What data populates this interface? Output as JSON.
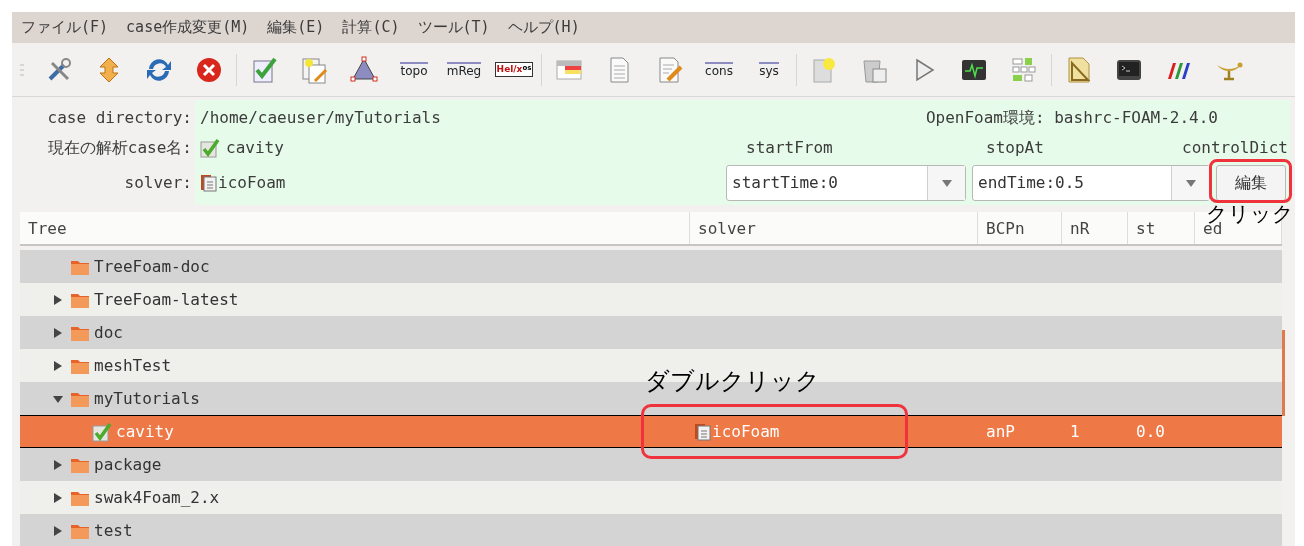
{
  "menu": [
    {
      "label": "ファイル(F)"
    },
    {
      "label": "case作成変更(M)"
    },
    {
      "label": "編集(E)"
    },
    {
      "label": "計算(C)"
    },
    {
      "label": "ツール(T)"
    },
    {
      "label": "ヘルプ(H)"
    }
  ],
  "toolbar": [
    [
      {
        "kind": "icon"
      },
      {
        "kind": "icon"
      },
      {
        "kind": "icon"
      },
      {
        "kind": "icon"
      }
    ],
    [
      {
        "kind": "icon"
      },
      {
        "kind": "icon"
      },
      {
        "kind": "icon"
      },
      {
        "kind": "label",
        "text": "topo"
      },
      {
        "kind": "label",
        "text": "mReg"
      },
      {
        "kind": "label",
        "text": "Hel/x",
        "sup": "os"
      }
    ],
    [
      {
        "kind": "icon"
      },
      {
        "kind": "icon"
      },
      {
        "kind": "icon"
      },
      {
        "kind": "label",
        "text": "cons"
      },
      {
        "kind": "label",
        "text": "sys"
      }
    ],
    [
      {
        "kind": "icon"
      },
      {
        "kind": "icon"
      },
      {
        "kind": "icon"
      },
      {
        "kind": "icon"
      },
      {
        "kind": "icon"
      }
    ],
    [
      {
        "kind": "icon"
      },
      {
        "kind": "icon"
      },
      {
        "kind": "icon"
      },
      {
        "kind": "icon"
      }
    ]
  ],
  "info": {
    "case_directory": {
      "label": "case directory:",
      "value": "/home/caeuser/myTutorials"
    },
    "case_name": {
      "label": "現在の解析case名:",
      "value": "cavity"
    },
    "solver": {
      "label": "solver:",
      "value": "icoFoam"
    },
    "environment": "OpenFoam環境: bashrc-FOAM-2.4.0"
  },
  "run_controls": {
    "start_from": {
      "label": "startFrom",
      "value": "startTime:0"
    },
    "stop_at": {
      "label": "stopAt",
      "value": "endTime:0.5"
    },
    "control_dict": {
      "label": "controlDict",
      "button": "編集",
      "callout": "クリック"
    }
  },
  "tree": {
    "columns": [
      "Tree",
      "solver",
      "BCPn",
      "nR",
      "st",
      "ed"
    ],
    "rows": [
      {
        "name": "TreeFoam-doc",
        "kind": "folder",
        "selected": false
      },
      {
        "name": "TreeFoam-latest",
        "kind": "folder",
        "expanded": false,
        "selected": false
      },
      {
        "name": "doc",
        "kind": "folder",
        "expanded": false,
        "selected": false
      },
      {
        "name": "meshTest",
        "kind": "folder",
        "expanded": false,
        "selected": false
      },
      {
        "name": "myTutorials",
        "kind": "folder",
        "expanded": true,
        "selected": false,
        "children": [
          {
            "name": "cavity",
            "kind": "case",
            "selected": true,
            "solver": "icoFoam",
            "bcpn": "anP",
            "nr": "1",
            "st": "0.0",
            "callout": "ダブルクリック"
          }
        ]
      },
      {
        "name": "package",
        "kind": "folder",
        "expanded": false,
        "selected": false
      },
      {
        "name": "swak4Foam_2.x",
        "kind": "folder",
        "expanded": false,
        "selected": false
      },
      {
        "name": "test",
        "kind": "folder",
        "expanded": false,
        "selected": false
      }
    ]
  }
}
